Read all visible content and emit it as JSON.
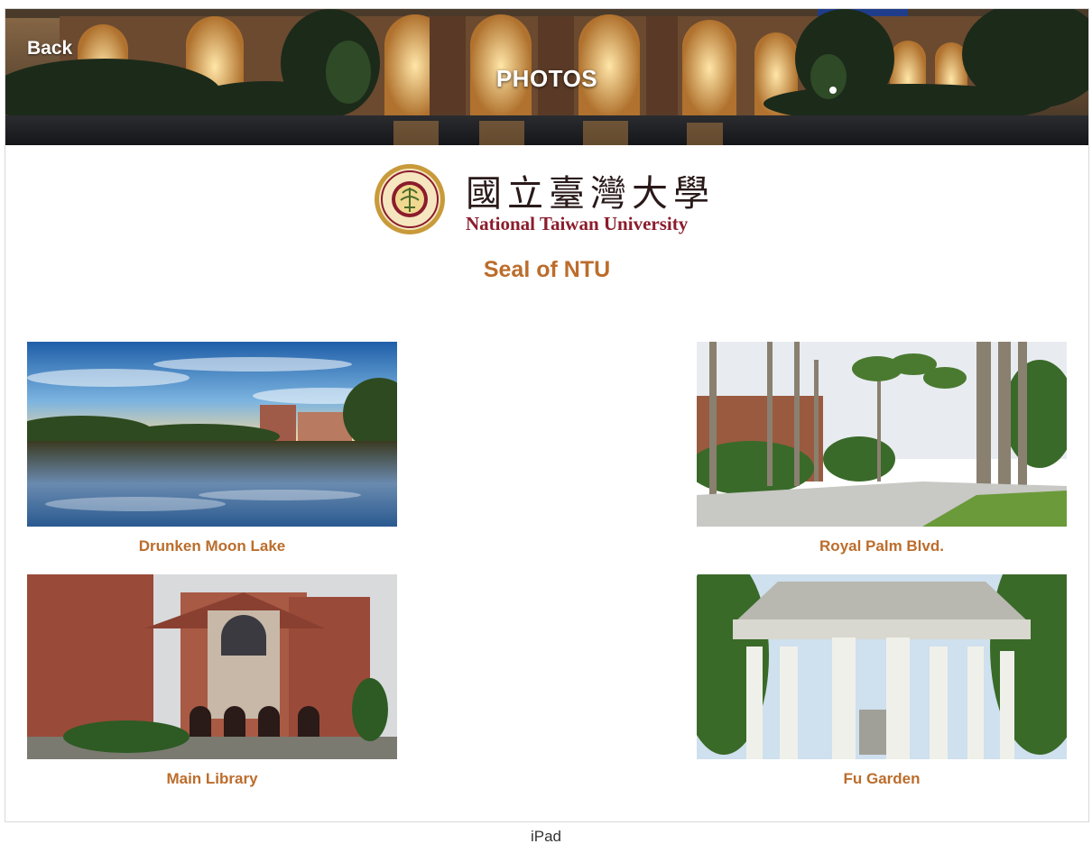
{
  "header": {
    "back_label": "Back",
    "title": "PHOTOS"
  },
  "logo": {
    "chinese_name": "國立臺灣大學",
    "english_name": "National Taiwan University"
  },
  "seal_caption": "Seal of NTU",
  "photos": [
    {
      "caption": "Drunken Moon Lake"
    },
    {
      "caption": "Royal Palm Blvd."
    },
    {
      "caption": "Main Library"
    },
    {
      "caption": "Fu Garden"
    }
  ],
  "device_label": "iPad",
  "colors": {
    "accent": "#bb6d2c",
    "logo_red": "#8b1c2c"
  }
}
